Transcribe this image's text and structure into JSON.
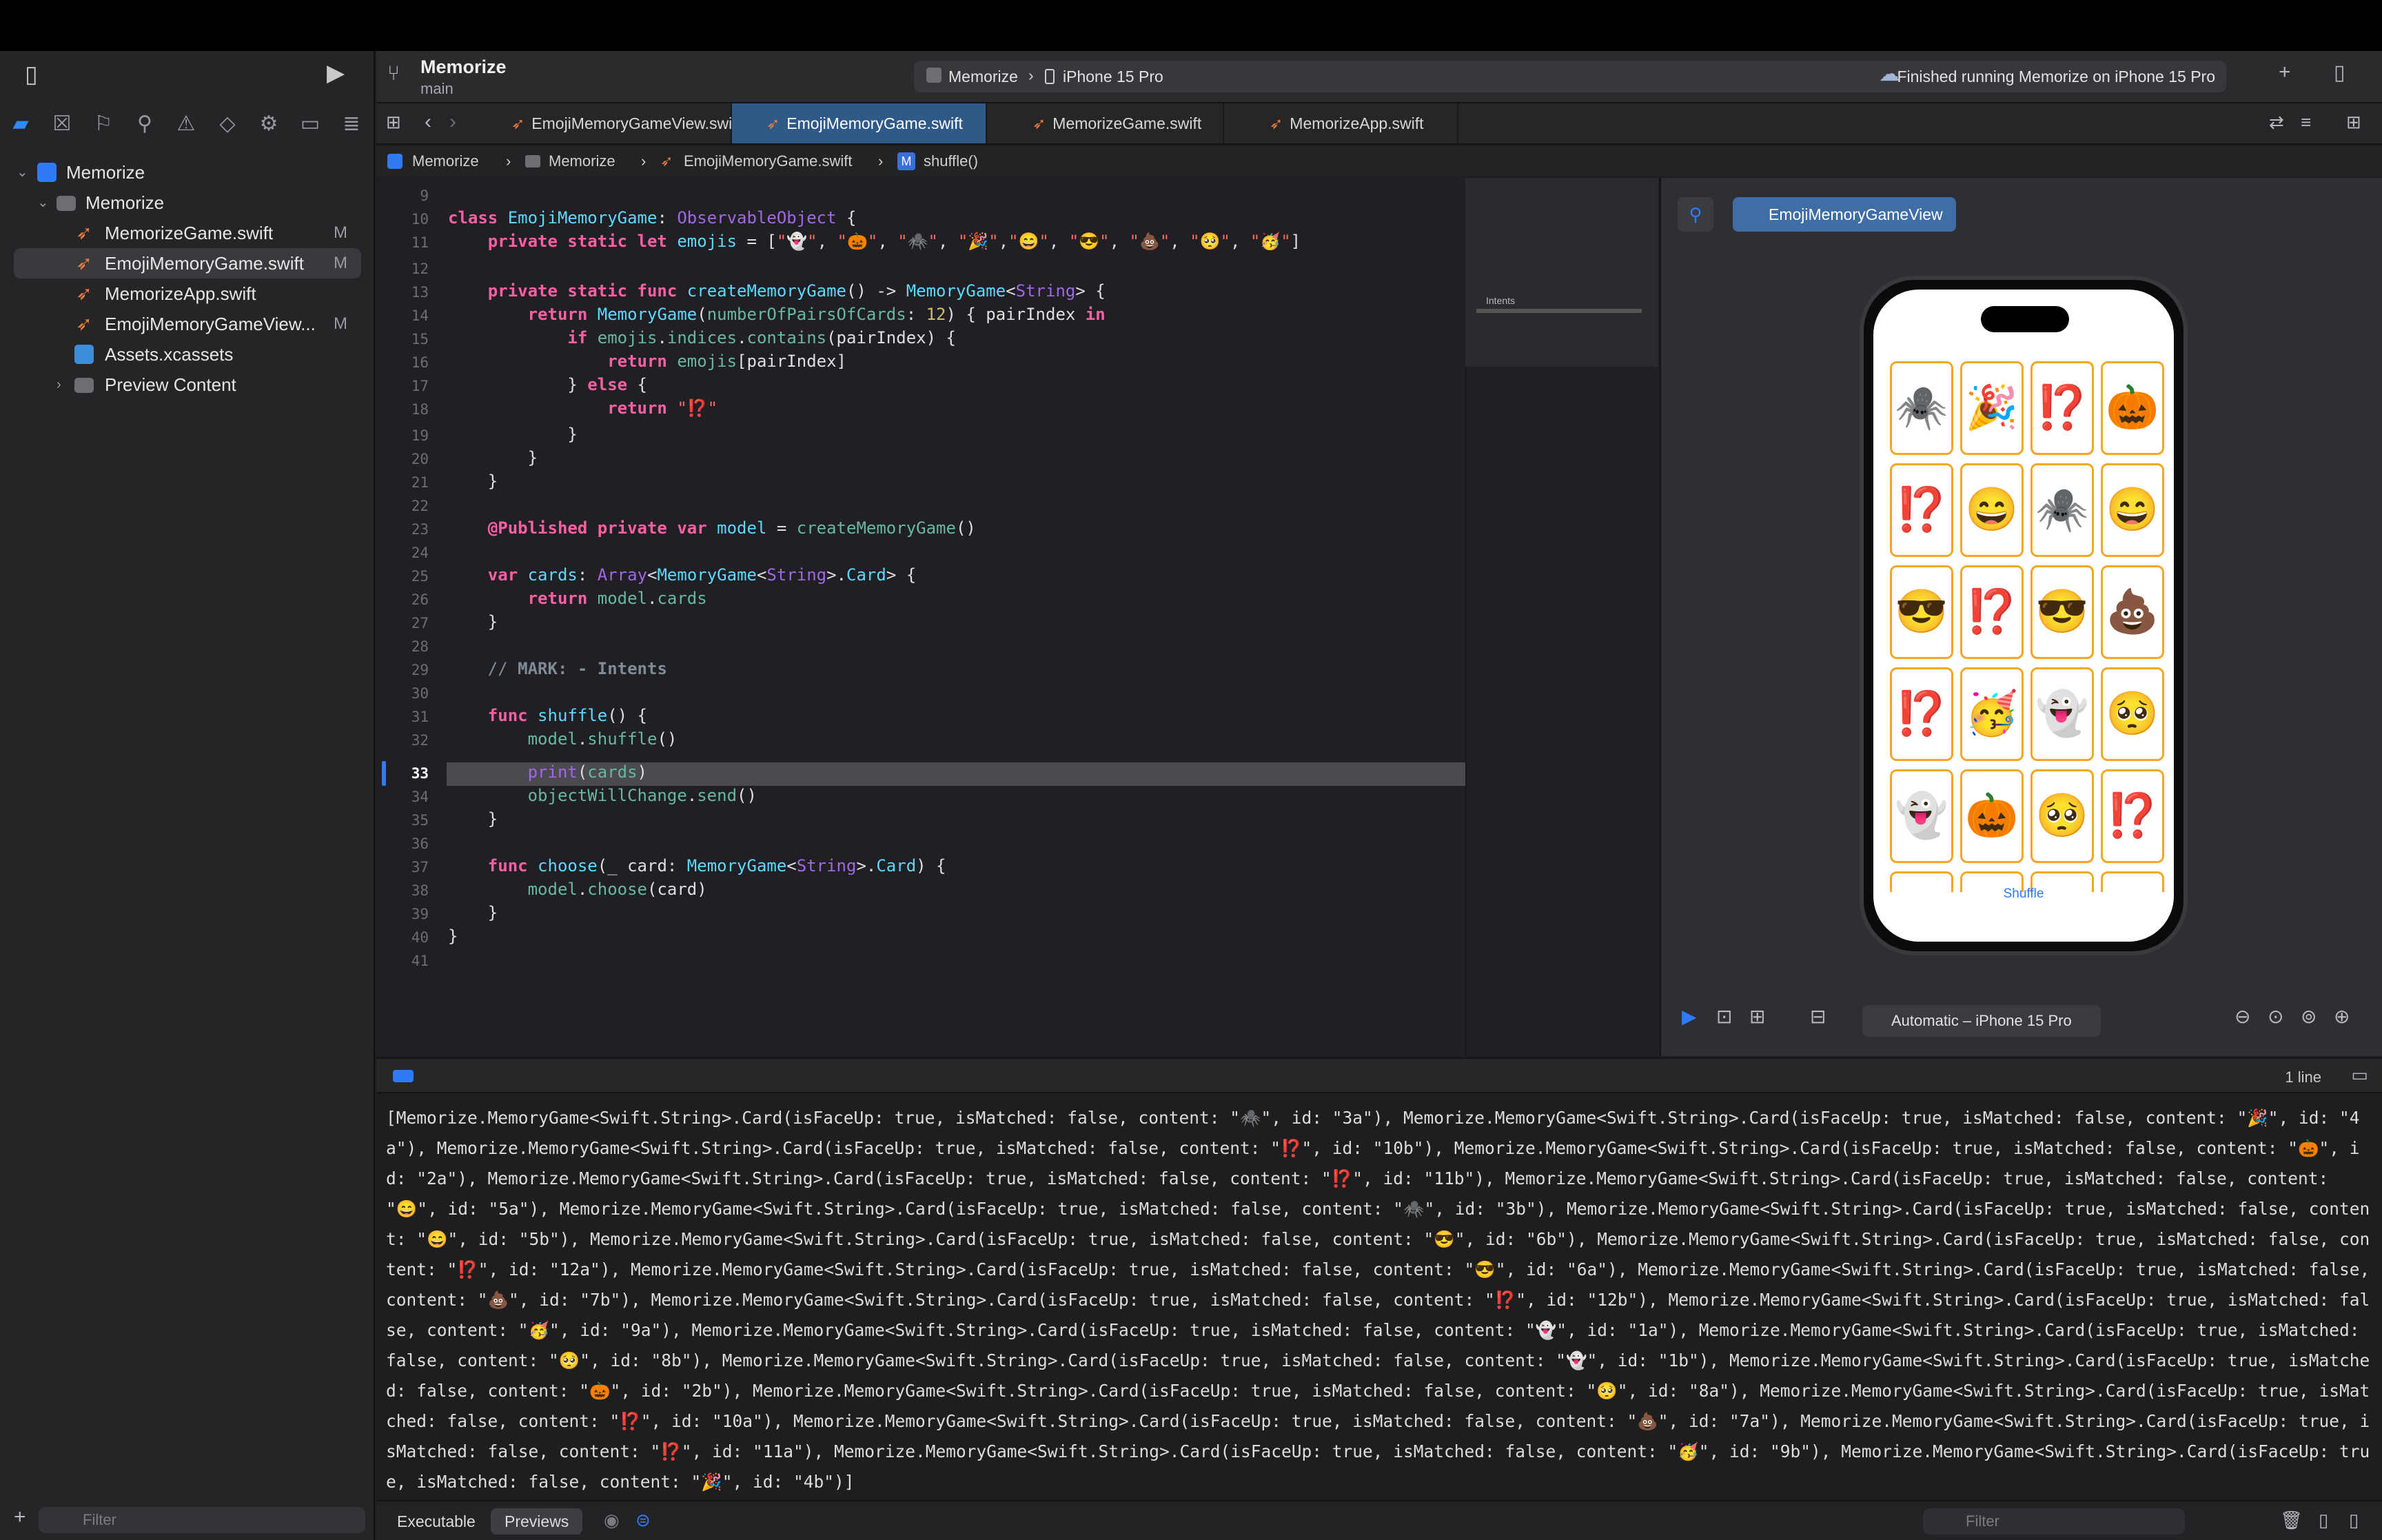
{
  "project": {
    "title": "Memorize",
    "branch": "main"
  },
  "scheme": {
    "name": "Memorize",
    "device": "iPhone 15 Pro",
    "status": "Finished running Memorize on iPhone 15 Pro"
  },
  "sidebar": {
    "items": [
      {
        "label": "Memorize",
        "kind": "project"
      },
      {
        "label": "Memorize",
        "kind": "folder"
      },
      {
        "label": "MemorizeGame.swift",
        "kind": "swift",
        "badge": "M"
      },
      {
        "label": "EmojiMemoryGame.swift",
        "kind": "swift",
        "badge": "M"
      },
      {
        "label": "MemorizeApp.swift",
        "kind": "swift",
        "badge": ""
      },
      {
        "label": "EmojiMemoryGameView...",
        "kind": "swift",
        "badge": "M"
      },
      {
        "label": "Assets.xcassets",
        "kind": "assets",
        "badge": ""
      },
      {
        "label": "Preview Content",
        "kind": "folder",
        "badge": ""
      }
    ],
    "filter_placeholder": "Filter"
  },
  "tabs": [
    "EmojiMemoryGameView.swift",
    "EmojiMemoryGame.swift",
    "MemorizeGame.swift",
    "MemorizeApp.swift"
  ],
  "breadcrumb": [
    "Memorize",
    "Memorize",
    "EmojiMemoryGame.swift",
    "shuffle()"
  ],
  "editor": {
    "current_line": "33",
    "lines": {
      "l9": "9",
      "l10": "10",
      "l11": "11",
      "l12": "12",
      "l13": "13",
      "l14": "14",
      "l15": "15",
      "l16": "16",
      "l17": "17",
      "l18": "18",
      "l19": "19",
      "l20": "20",
      "l21": "21",
      "l22": "22",
      "l23": "23",
      "l24": "24",
      "l25": "25",
      "l26": "26",
      "l27": "27",
      "l28": "28",
      "l29": "29",
      "l30": "30",
      "l31": "31",
      "l32": "32",
      "l33": "33",
      "l34": "34",
      "l35": "35",
      "l36": "36",
      "l37": "37",
      "l38": "38",
      "l39": "39",
      "l40": "40",
      "l41": "41"
    },
    "minimap_label": "Intents"
  },
  "preview": {
    "pin_label": "EmojiMemoryGameView",
    "cards": [
      "🕷️",
      "🎉",
      "⁉️",
      "🎃",
      "⁉️",
      "😄",
      "🕷️",
      "😄",
      "😎",
      "⁉️",
      "😎",
      "💩",
      "⁉️",
      "🥳",
      "👻",
      "🥺",
      "👻",
      "🎃",
      "🥺",
      "⁉️"
    ],
    "shuffle_label": "Shuffle",
    "device_selector": "Automatic – iPhone 15 Pro"
  },
  "debug": {
    "line_count": "1 line",
    "console": "[Memorize.MemoryGame<Swift.String>.Card(isFaceUp: true, isMatched: false, content: \"🕷️\", id: \"3a\"), Memorize.MemoryGame<Swift.String>.Card(isFaceUp: true, isMatched: false, content: \"🎉\", id: \"4a\"), Memorize.MemoryGame<Swift.String>.Card(isFaceUp: true, isMatched: false, content: \"⁉️\", id: \"10b\"), Memorize.MemoryGame<Swift.String>.Card(isFaceUp: true, isMatched: false, content: \"🎃\", id: \"2a\"), Memorize.MemoryGame<Swift.String>.Card(isFaceUp: true, isMatched: false, content: \"⁉️\", id: \"11b\"), Memorize.MemoryGame<Swift.String>.Card(isFaceUp: true, isMatched: false, content: \"😄\", id: \"5a\"), Memorize.MemoryGame<Swift.String>.Card(isFaceUp: true, isMatched: false, content: \"🕷️\", id: \"3b\"), Memorize.MemoryGame<Swift.String>.Card(isFaceUp: true, isMatched: false, content: \"😄\", id: \"5b\"), Memorize.MemoryGame<Swift.String>.Card(isFaceUp: true, isMatched: false, content: \"😎\", id: \"6b\"), Memorize.MemoryGame<Swift.String>.Card(isFaceUp: true, isMatched: false, content: \"⁉️\", id: \"12a\"), Memorize.MemoryGame<Swift.String>.Card(isFaceUp: true, isMatched: false, content: \"😎\", id: \"6a\"), Memorize.MemoryGame<Swift.String>.Card(isFaceUp: true, isMatched: false, content: \"💩\", id: \"7b\"), Memorize.MemoryGame<Swift.String>.Card(isFaceUp: true, isMatched: false, content: \"⁉️\", id: \"12b\"), Memorize.MemoryGame<Swift.String>.Card(isFaceUp: true, isMatched: false, content: \"🥳\", id: \"9a\"), Memorize.MemoryGame<Swift.String>.Card(isFaceUp: true, isMatched: false, content: \"👻\", id: \"1a\"), Memorize.MemoryGame<Swift.String>.Card(isFaceUp: true, isMatched: false, content: \"🥺\", id: \"8b\"), Memorize.MemoryGame<Swift.String>.Card(isFaceUp: true, isMatched: false, content: \"👻\", id: \"1b\"), Memorize.MemoryGame<Swift.String>.Card(isFaceUp: true, isMatched: false, content: \"🎃\", id: \"2b\"), Memorize.MemoryGame<Swift.String>.Card(isFaceUp: true, isMatched: false, content: \"🥺\", id: \"8a\"), Memorize.MemoryGame<Swift.String>.Card(isFaceUp: true, isMatched: false, content: \"⁉️\", id: \"10a\"), Memorize.MemoryGame<Swift.String>.Card(isFaceUp: true, isMatched: false, content: \"💩\", id: \"7a\"), Memorize.MemoryGame<Swift.String>.Card(isFaceUp: true, isMatched: false, content: \"⁉️\", id: \"11a\"), Memorize.MemoryGame<Swift.String>.Card(isFaceUp: true, isMatched: false, content: \"🥳\", id: \"9b\"), Memorize.MemoryGame<Swift.String>.Card(isFaceUp: true, isMatched: false, content: \"🎉\", id: \"4b\")]",
    "tabs": [
      "Executable",
      "Previews"
    ],
    "filter_placeholder": "Filter"
  }
}
